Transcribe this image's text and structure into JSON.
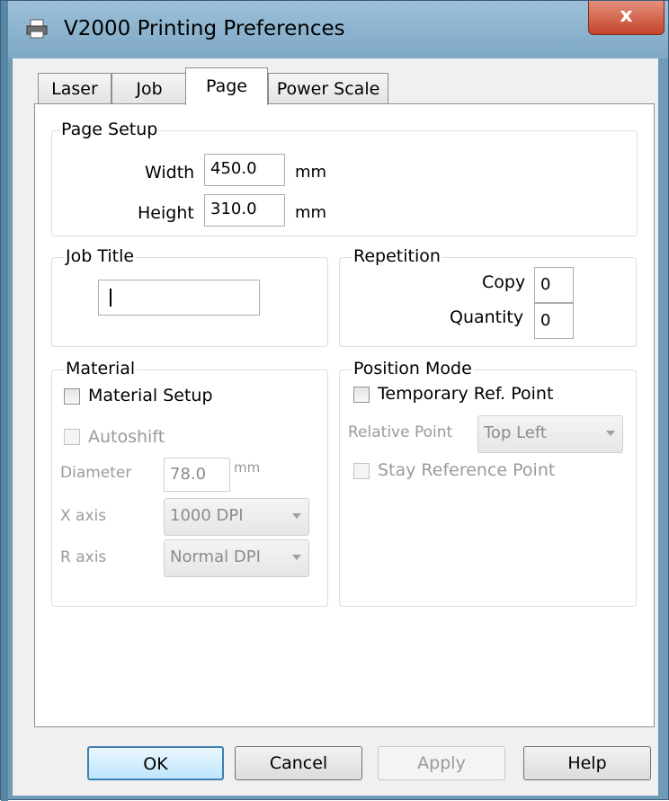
{
  "window": {
    "title": "V2000 Printing Preferences",
    "close_glyph": "x"
  },
  "tabs": [
    {
      "label": "Laser",
      "active": false
    },
    {
      "label": "Job",
      "active": false
    },
    {
      "label": "Page",
      "active": true
    },
    {
      "label": "Power Scale",
      "active": false
    }
  ],
  "page_setup": {
    "group_label": "Page Setup",
    "width_label": "Width",
    "width_value": "450.0",
    "width_unit": "mm",
    "height_label": "Height",
    "height_value": "310.0",
    "height_unit": "mm"
  },
  "job_title": {
    "group_label": "Job Title",
    "value": ""
  },
  "repetition": {
    "group_label": "Repetition",
    "copy_label": "Copy",
    "copy_value": "0",
    "quantity_label": "Quantity",
    "quantity_value": "0"
  },
  "material": {
    "group_label": "Material",
    "material_setup_label": "Material Setup",
    "material_setup_checked": false,
    "autoshift_label": "Autoshift",
    "autoshift_checked": false,
    "diameter_label": "Diameter",
    "diameter_value": "78.0",
    "diameter_unit": "mm",
    "x_axis_label": "X axis",
    "x_axis_value": "1000 DPI",
    "r_axis_label": "R axis",
    "r_axis_value": "Normal DPI"
  },
  "position_mode": {
    "group_label": "Position Mode",
    "temp_ref_label": "Temporary Ref. Point",
    "temp_ref_checked": false,
    "relative_point_label": "Relative Point",
    "relative_point_value": "Top Left",
    "stay_ref_label": "Stay Reference Point",
    "stay_ref_checked": false
  },
  "buttons": {
    "ok": "OK",
    "cancel": "Cancel",
    "apply": "Apply",
    "help": "Help"
  },
  "colors": {
    "titlebar": "#7ea8c6",
    "close_button": "#c4432b",
    "default_button_border": "#3c7fb1"
  }
}
